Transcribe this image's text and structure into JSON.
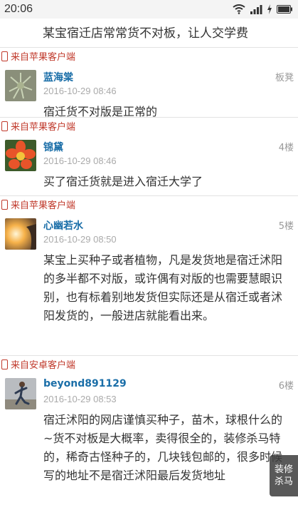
{
  "status": {
    "time": "20:06"
  },
  "top_text": "某宝宿迁店常常货不对板，让人交学费",
  "posts": [
    {
      "client": "来自苹果客户端",
      "user": "蓝海棠",
      "floor": "板凳",
      "date": "2016-10-29 08:46",
      "content": "宿迁货不对版是正常的",
      "avatar_icon": "succulent-plant-avatar"
    },
    {
      "client": "来自苹果客户端",
      "user": "锦黛",
      "floor": "4楼",
      "date": "2016-10-29 08:46",
      "content": "买了宿迁货就是进入宿迁大学了",
      "avatar_icon": "flower-avatar"
    },
    {
      "client": "来自苹果客户端",
      "user": "心幽若水",
      "floor": "5楼",
      "date": "2016-10-29 08:50",
      "content": "某宝上买种子或者植物，凡是发货地是宿迁沭阳的多半都不对版，或许偶有对版的也需要慧眼识别，也有标着别地发货但实际还是从宿迁或者沭阳发货的，一般进店就能看出来。",
      "avatar_icon": "sunset-avatar"
    },
    {
      "client": "来自安卓客户端",
      "user": "beyond891129",
      "floor": "6楼",
      "date": "2016-10-29 08:53",
      "content": "宿迁沭阳的网店谨慎买种子，苗木，球根什么的~货不对板是大概率，卖得很全的，装修杀马特的，稀奇古怪种子的，几块钱包邮的，很多时候写的地址不是宿迁沭阳最后发货地址",
      "avatar_icon": "runner-avatar"
    }
  ],
  "float_button": {
    "line1": "装修",
    "line2": "杀马"
  }
}
